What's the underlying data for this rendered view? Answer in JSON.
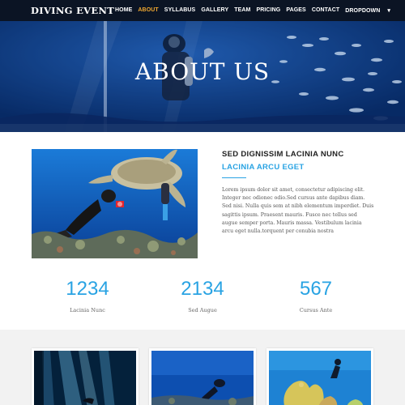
{
  "brand": "DIVING EVENT",
  "nav": {
    "items": [
      "HOME",
      "ABOUT",
      "SYLLABUS",
      "GALLERY",
      "TEAM",
      "PRICING",
      "PAGES",
      "CONTACT",
      "DROPDOWN"
    ],
    "active_index": 1,
    "dropdown_caret": "▾"
  },
  "hero": {
    "title": "ABOUT US"
  },
  "about": {
    "heading": "SED DIGNISSIM LACINIA NUNC",
    "subheading": "LACINIA ARCU EGET",
    "body": "Lorem ipsum dolor sit amet, consectetur adipiscing elit. Integer nec odionec odio.Sed cursus ante dapibus diam. Sed nisi. Nulla quis sem at nibh elementum imperdiet. Duis sagittis ipsum. Praesent mauris. Fusce nec tellus sed augue semper porta. Mauris massa. Vestibulum lacinia arcu eget nulla.torquent per conubia nostra"
  },
  "stats": [
    {
      "number": "1234",
      "label": "Lacinia Nunc"
    },
    {
      "number": "2134",
      "label": "Sed Augue"
    },
    {
      "number": "567",
      "label": "Cursus Ante"
    }
  ],
  "colors": {
    "accent": "#29a3e3",
    "nav_bg": "#0b1424",
    "nav_active": "#f0a830",
    "hero_blue": "#1250a7"
  }
}
